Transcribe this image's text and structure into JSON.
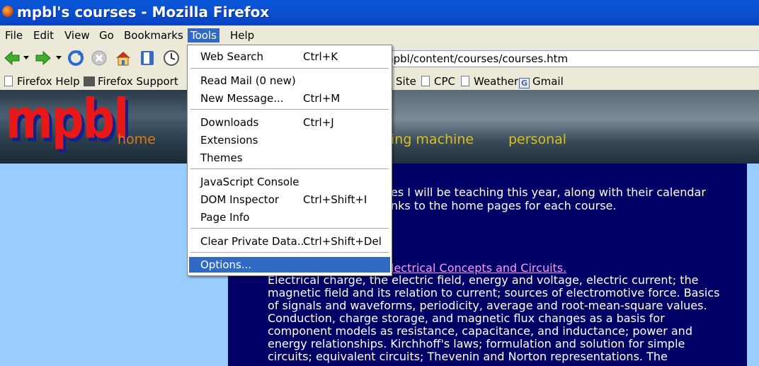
{
  "window": {
    "title": "mpbl's courses - Mozilla Firefox"
  },
  "menubar": [
    {
      "label": "File"
    },
    {
      "label": "Edit"
    },
    {
      "label": "View"
    },
    {
      "label": "Go"
    },
    {
      "label": "Bookmarks"
    },
    {
      "label": "Tools"
    },
    {
      "label": "Help"
    }
  ],
  "address": {
    "url_visible": "mpbl/content/courses/courses.htm"
  },
  "bookmarks": [
    {
      "label": "Firefox Help"
    },
    {
      "label": "Firefox Support"
    },
    {
      "label": "Site"
    },
    {
      "label": "CPC"
    },
    {
      "label": "Weather"
    },
    {
      "label": "Gmail"
    }
  ],
  "banner": {
    "logo": "mpbl",
    "nav": [
      {
        "label": "home"
      },
      {
        "label": "ing machine"
      },
      {
        "label": "personal"
      }
    ]
  },
  "content": {
    "intro_line1": "es I will be teaching this year, along with their calendar",
    "intro_line2": "nks to the home pages for each course.",
    "course_link": "lectrical Concepts and Circuits.",
    "desc": [
      "Electrical charge, the electric field, energy and voltage, electric current; the",
      "magnetic field and its relation to current; sources of electromotive force. Basics",
      "of signals and waveforms, periodicity, average and root-mean-square values.",
      "Conduction, charge storage, and magnetic flux changes as a basis for",
      "component models as resistance, capacitance, and inductance; power and",
      "energy relationships. Kirchhoff's laws; formulation and solution for simple",
      "circuits; equivalent circuits; Thevenin and Norton representations. The"
    ]
  },
  "tools_menu": {
    "items": [
      {
        "label": "Web Search",
        "shortcut": "Ctrl+K"
      },
      {
        "label": "Read Mail (0 new)",
        "shortcut": ""
      },
      {
        "label": "New Message...",
        "shortcut": "Ctrl+M"
      },
      {
        "label": "Downloads",
        "shortcut": "Ctrl+J"
      },
      {
        "label": "Extensions",
        "shortcut": ""
      },
      {
        "label": "Themes",
        "shortcut": ""
      },
      {
        "label": "JavaScript Console",
        "shortcut": ""
      },
      {
        "label": "DOM Inspector",
        "shortcut": "Ctrl+Shift+I"
      },
      {
        "label": "Page Info",
        "shortcut": ""
      },
      {
        "label": "Clear Private Data...",
        "shortcut": "Ctrl+Shift+Del"
      },
      {
        "label": "Options...",
        "shortcut": ""
      }
    ],
    "selected": "Options..."
  },
  "colors": {
    "titlebar": "#0a4fd1",
    "menu_highlight": "#316ac5",
    "content_bg": "#000066",
    "page_bg": "#99ccff",
    "logo": "#e81818",
    "nav_home": "#e07a10",
    "nav_other": "#d8c020"
  }
}
